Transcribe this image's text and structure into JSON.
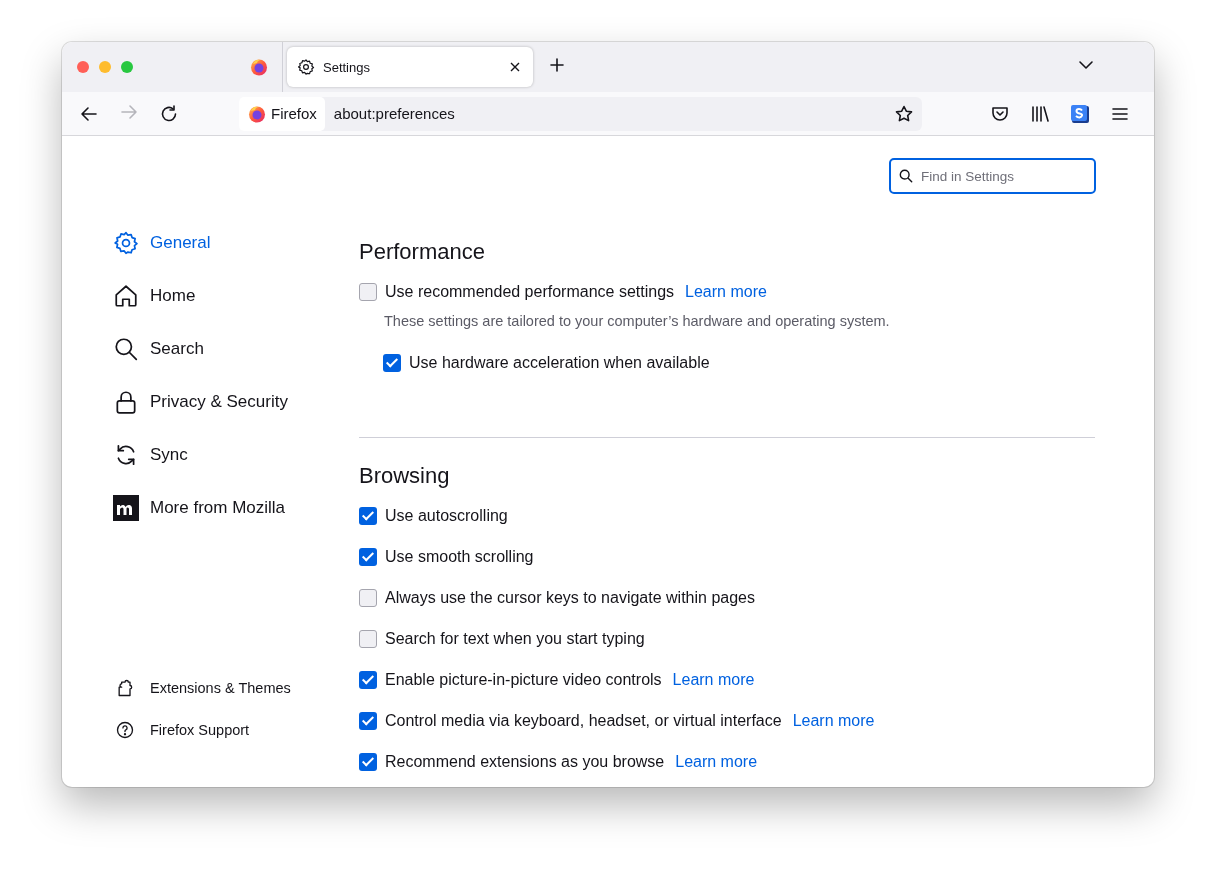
{
  "tabs": [
    {
      "title": "Settings",
      "selected": true
    }
  ],
  "toolbar": {
    "identity": "Firefox",
    "url": "about:preferences"
  },
  "search": {
    "placeholder": "Find in Settings"
  },
  "sidebar": {
    "categories": [
      {
        "label": "General",
        "selected": true
      },
      {
        "label": "Home",
        "selected": false
      },
      {
        "label": "Search",
        "selected": false
      },
      {
        "label": "Privacy & Security",
        "selected": false
      },
      {
        "label": "Sync",
        "selected": false
      },
      {
        "label": "More from Mozilla",
        "selected": false
      }
    ],
    "footer": [
      "Extensions & Themes",
      "Firefox Support"
    ]
  },
  "sections": [
    {
      "title": "Performance",
      "items": [
        {
          "label": "Use recommended performance settings",
          "checked": false,
          "link": "Learn more",
          "description": "These settings are tailored to your computer’s hardware and operating system.",
          "children": [
            {
              "label": "Use hardware acceleration when available",
              "checked": true
            }
          ]
        }
      ]
    },
    {
      "title": "Browsing",
      "items": [
        {
          "label": "Use autoscrolling",
          "checked": true
        },
        {
          "label": "Use smooth scrolling",
          "checked": true
        },
        {
          "label": "Always use the cursor keys to navigate within pages",
          "checked": false
        },
        {
          "label": "Search for text when you start typing",
          "checked": false
        },
        {
          "label": "Enable picture-in-picture video controls",
          "checked": true,
          "link": "Learn more"
        },
        {
          "label": "Control media via keyboard, headset, or virtual interface",
          "checked": true,
          "link": "Learn more"
        },
        {
          "label": "Recommend extensions as you browse",
          "checked": true,
          "link": "Learn more"
        }
      ]
    }
  ]
}
